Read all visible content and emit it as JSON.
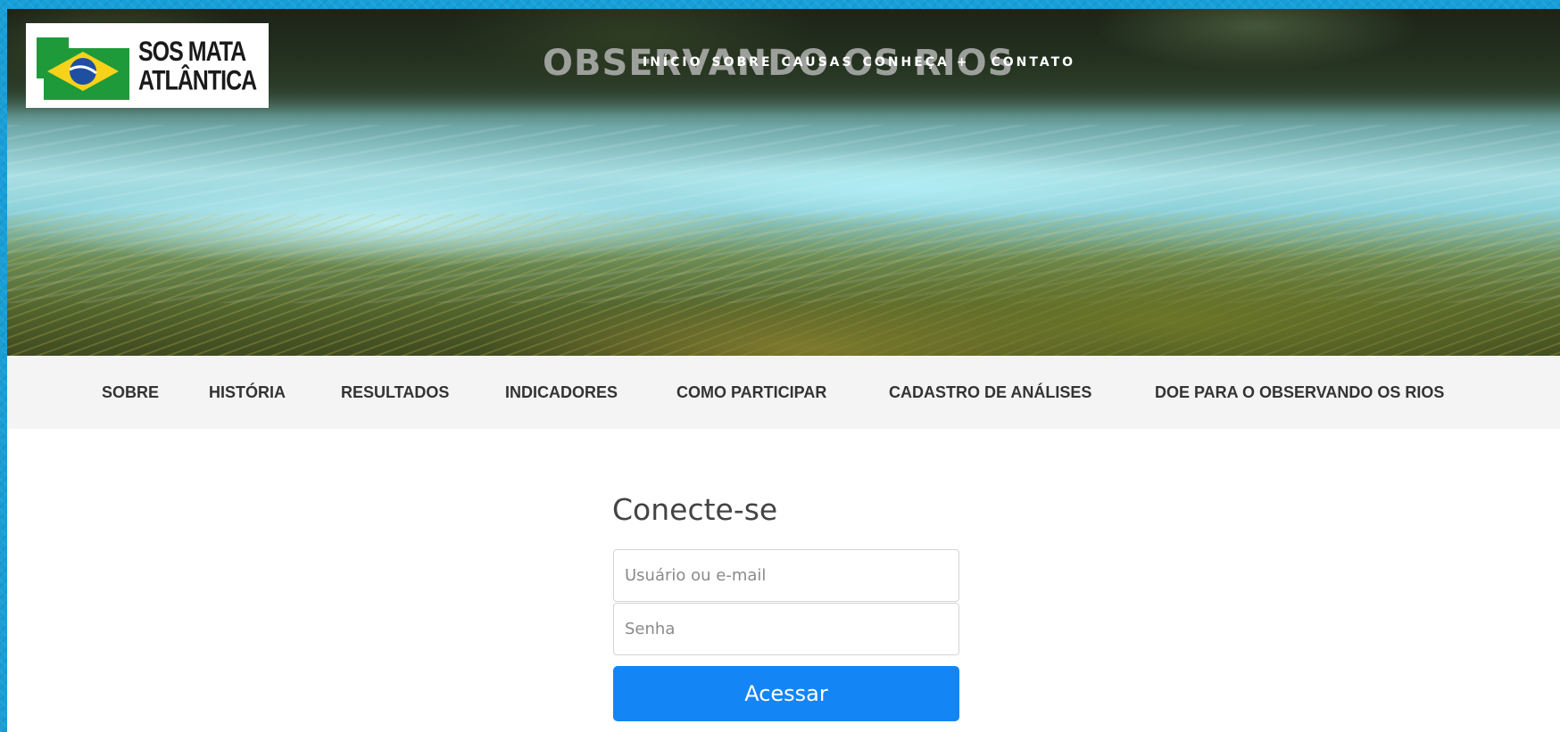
{
  "brand": {
    "logo_line1": "SOS MATA",
    "logo_line2": "ATLÂNTICA",
    "site_title": "OBSERVANDO OS RIOS",
    "colors": {
      "frame": "#169fd8",
      "button": "#1485f5",
      "nav_bg": "#f4f4f4"
    }
  },
  "top_nav": [
    {
      "label": "INÍCIO"
    },
    {
      "label": "SOBRE"
    },
    {
      "label": "CAUSAS"
    },
    {
      "label": "CONHEÇA +"
    },
    {
      "label": "CONTATO"
    }
  ],
  "secondary_nav": [
    {
      "label": "SOBRE"
    },
    {
      "label": "HISTÓRIA"
    },
    {
      "label": "RESULTADOS"
    },
    {
      "label": "INDICADORES"
    },
    {
      "label": "COMO PARTICIPAR"
    },
    {
      "label": "CADASTRO DE ANÁLISES"
    },
    {
      "label": "DOE PARA O OBSERVANDO OS RIOS"
    }
  ],
  "login": {
    "title": "Conecte-se",
    "username_placeholder": "Usuário ou e-mail",
    "password_placeholder": "Senha",
    "submit_label": "Acessar"
  }
}
